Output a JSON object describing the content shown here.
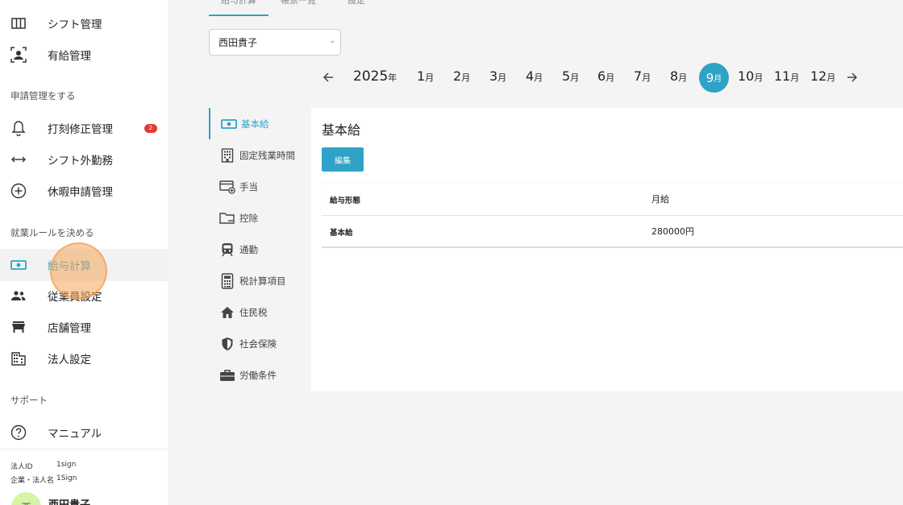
{
  "sidebar": {
    "top_items": [
      {
        "label": "シフト管理",
        "icon": "calendar-columns-icon"
      },
      {
        "label": "有給管理",
        "icon": "person-frame-icon"
      }
    ],
    "section_request": "申請管理をする",
    "request_items": [
      {
        "label": "打刻修正管理",
        "icon": "bell-icon",
        "badge": "2"
      },
      {
        "label": "シフト外勤務",
        "icon": "horizontal-arrows-icon"
      },
      {
        "label": "休暇申請管理",
        "icon": "plus-circle-icon"
      }
    ],
    "section_rules": "就業ルールを決める",
    "rules_items": [
      {
        "label": "給与計算",
        "icon": "money-icon"
      },
      {
        "label": "従業員設定",
        "icon": "people-icon"
      },
      {
        "label": "店舗管理",
        "icon": "store-icon"
      },
      {
        "label": "法人設定",
        "icon": "building-icon"
      }
    ],
    "section_support": "サポート",
    "support_items": [
      {
        "label": "マニュアル",
        "icon": "question-circle-icon"
      }
    ],
    "footer": {
      "corp_id_label": "法人ID",
      "corp_id_value": "1sign",
      "corp_name_label": "企業・法人名",
      "corp_name_value": "1Sign",
      "avatar_initial": "西",
      "user_name": "西田貴子"
    }
  },
  "top_tabs": [
    "給与計算",
    "帳票一覧",
    "設定"
  ],
  "employee_select": {
    "value": "西田貴子"
  },
  "month_selector": {
    "year": "2025",
    "year_unit": "年",
    "month_unit": "月",
    "months": [
      "1",
      "2",
      "3",
      "4",
      "5",
      "6",
      "7",
      "8",
      "9",
      "10",
      "11",
      "12"
    ],
    "selected": "9",
    "accent": "#2ea3c7"
  },
  "sub_menu": [
    {
      "label": "基本給",
      "icon": "money-icon"
    },
    {
      "label": "固定残業時間",
      "icon": "building-icon"
    },
    {
      "label": "手当",
      "icon": "card-plus-icon"
    },
    {
      "label": "控除",
      "icon": "folder-minus-icon"
    },
    {
      "label": "通勤",
      "icon": "train-icon"
    },
    {
      "label": "税計算項目",
      "icon": "calculator-icon"
    },
    {
      "label": "住民税",
      "icon": "home-icon"
    },
    {
      "label": "社会保険",
      "icon": "shield-icon"
    },
    {
      "label": "労働条件",
      "icon": "briefcase-icon"
    }
  ],
  "panel": {
    "title": "基本給",
    "edit_label": "編集",
    "rows": [
      {
        "key": "給与形態",
        "value": "月給"
      },
      {
        "key": "基本給",
        "value": "280000円"
      }
    ]
  }
}
